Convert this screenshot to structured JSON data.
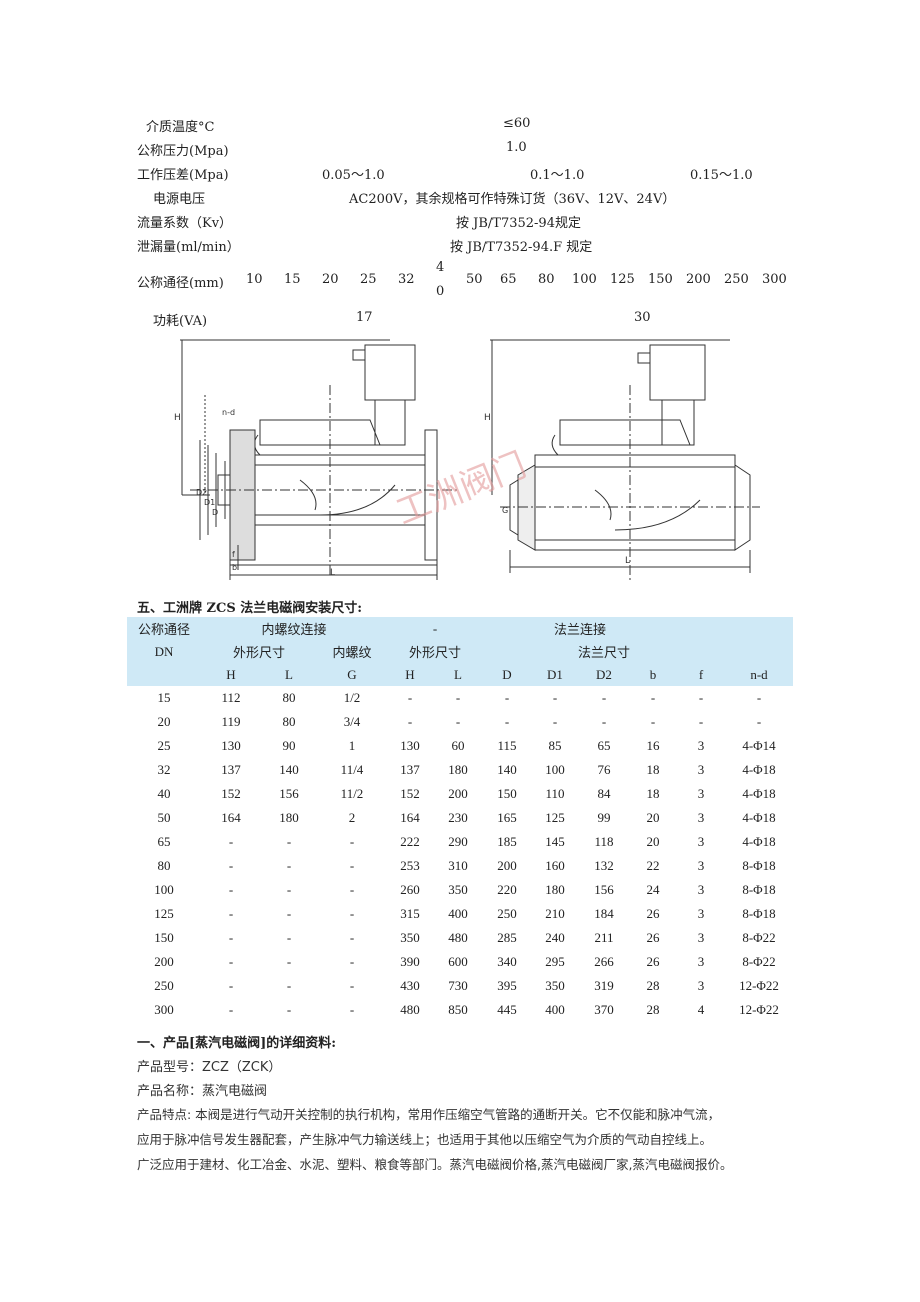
{
  "specs": {
    "temp_label": "介质温度°C",
    "temp_value": "≤60",
    "pressure_label": "公称压力(Mpa)",
    "pressure_value": "1.0",
    "diff_label": "工作压差(Mpa)",
    "diff_values": [
      "0.05～1.0",
      "0.1～1.0",
      "0.15～1.0"
    ],
    "voltage_label": "电源电压",
    "voltage_value": "AC200V，其余规格可作特殊订货（36V、12V、24V）",
    "flow_label": "流量系数（Kv）",
    "flow_value": "按 JB/T7352-94规定",
    "leak_label": "泄漏量(ml/min）",
    "leak_value": "按 JB/T7352-94.F 规定",
    "bore_label": "公称通径(mm)",
    "bore_values": [
      "10",
      "15",
      "20",
      "25",
      "32",
      "4",
      "0",
      "50",
      "65",
      "80",
      "100",
      "125",
      "150",
      "200",
      "250",
      "300"
    ],
    "power_label": "功耗(VA)",
    "power_values": [
      "17",
      "30"
    ]
  },
  "drawing": {
    "left_labels": [
      "H",
      "n-d",
      "D2",
      "D1",
      "D",
      "f",
      "b",
      "L"
    ],
    "right_labels": [
      "H",
      "G",
      "L"
    ],
    "watermark": "工洲阀门"
  },
  "table_title": "五、工洲牌 ZCS 法兰电磁阀安装尺寸:",
  "table": {
    "header1": [
      "公称通径",
      "内螺纹连接",
      "-",
      "法兰连接"
    ],
    "header2": [
      "DN",
      "外形尺寸",
      "内螺纹",
      "外形尺寸",
      "法兰尺寸"
    ],
    "header3": [
      "H",
      "L",
      "G",
      "H",
      "L",
      "D",
      "D1",
      "D2",
      "b",
      "f",
      "n-d"
    ],
    "rows": [
      [
        "15",
        "112",
        "80",
        "1/2",
        "-",
        "-",
        "-",
        "-",
        "-",
        "-",
        "-",
        "-"
      ],
      [
        "20",
        "119",
        "80",
        "3/4",
        "-",
        "-",
        "-",
        "-",
        "-",
        "-",
        "-",
        "-"
      ],
      [
        "25",
        "130",
        "90",
        "1",
        "130",
        "60",
        "115",
        "85",
        "65",
        "16",
        "3",
        "4-Φ14"
      ],
      [
        "32",
        "137",
        "140",
        "11/4",
        "137",
        "180",
        "140",
        "100",
        "76",
        "18",
        "3",
        "4-Φ18"
      ],
      [
        "40",
        "152",
        "156",
        "11/2",
        "152",
        "200",
        "150",
        "110",
        "84",
        "18",
        "3",
        "4-Φ18"
      ],
      [
        "50",
        "164",
        "180",
        "2",
        "164",
        "230",
        "165",
        "125",
        "99",
        "20",
        "3",
        "4-Φ18"
      ],
      [
        "65",
        "-",
        "-",
        "-",
        "222",
        "290",
        "185",
        "145",
        "118",
        "20",
        "3",
        "4-Φ18"
      ],
      [
        "80",
        "-",
        "-",
        "-",
        "253",
        "310",
        "200",
        "160",
        "132",
        "22",
        "3",
        "8-Φ18"
      ],
      [
        "100",
        "-",
        "-",
        "-",
        "260",
        "350",
        "220",
        "180",
        "156",
        "24",
        "3",
        "8-Φ18"
      ],
      [
        "125",
        "-",
        "-",
        "-",
        "315",
        "400",
        "250",
        "210",
        "184",
        "26",
        "3",
        "8-Φ18"
      ],
      [
        "150",
        "-",
        "-",
        "-",
        "350",
        "480",
        "285",
        "240",
        "211",
        "26",
        "3",
        "8-Φ22"
      ],
      [
        "200",
        "-",
        "-",
        "-",
        "390",
        "600",
        "340",
        "295",
        "266",
        "26",
        "3",
        "8-Φ22"
      ],
      [
        "250",
        "-",
        "-",
        "-",
        "430",
        "730",
        "395",
        "350",
        "319",
        "28",
        "3",
        "12-Φ22"
      ],
      [
        "300",
        "-",
        "-",
        "-",
        "480",
        "850",
        "445",
        "400",
        "370",
        "28",
        "4",
        "12-Φ22"
      ]
    ]
  },
  "product": {
    "heading": "一、产品[蒸汽电磁阀]的详细资料:",
    "model": "产品型号：ZCZ（ZCK）",
    "name": "产品名称：蒸汽电磁阀",
    "feature_lines": [
      "产品特点: 本阀是进行气动开关控制的执行机构，常用作压缩空气管路的通断开关。它不仅能和脉冲气流，",
      "应用于脉冲信号发生器配套，产生脉冲气力输送线上；也适用于其他以压缩空气为介质的气动自控线上。",
      "广泛应用于建材、化工冶金、水泥、塑料、粮食等部门。蒸汽电磁阀价格,蒸汽电磁阀厂家,蒸汽电磁阀报价。"
    ]
  }
}
